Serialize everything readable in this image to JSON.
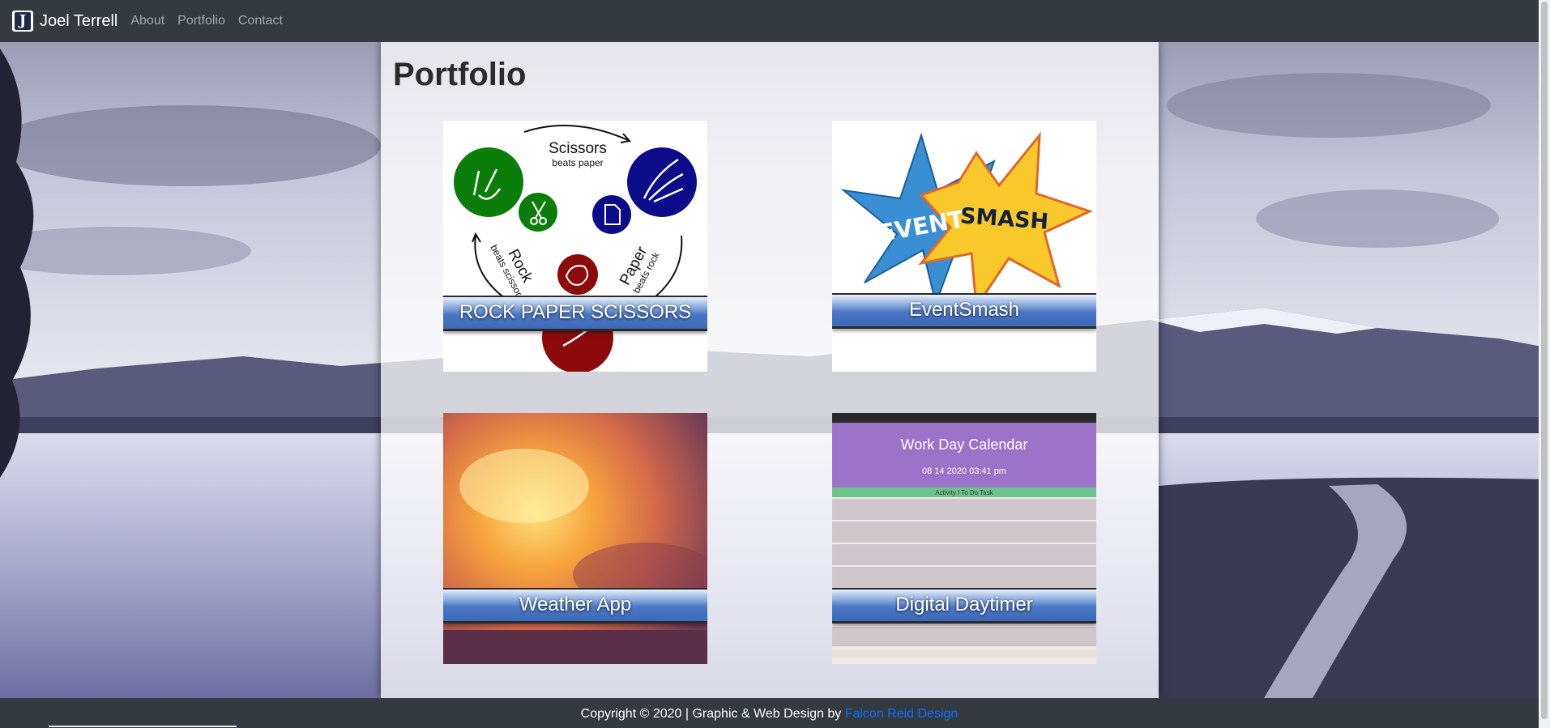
{
  "navbar": {
    "brand_letter": "J",
    "brand_name": "Joel Terrell",
    "links": [
      "About",
      "Portfolio",
      "Contact"
    ]
  },
  "main": {
    "title": "Portfolio",
    "projects": [
      {
        "label": "ROCK PAPER SCISSORS",
        "art_text": {
          "scissors": "Scissors",
          "scissors_beats": "beats paper",
          "rock": "Rock",
          "rock_beats": "beats scissors",
          "paper": "Paper",
          "paper_beats": "beats rock"
        }
      },
      {
        "label": "EventSmash",
        "art_text": {
          "event": "EVENT",
          "smash": "SMASH"
        }
      },
      {
        "label": "Weather App"
      },
      {
        "label": "Digital Daytimer",
        "art_text": {
          "heading": "Work Day Calendar",
          "datetime": "08 14 2020 03:41 pm",
          "row_label": "Activity / To Do Task"
        }
      }
    ]
  },
  "footer": {
    "copyright": "Copyright © 2020 | Graphic & Web Design by ",
    "link_text": "Falcon Reid Design"
  },
  "colors": {
    "navbar_bg": "#343a40",
    "link_blue": "#0d6efd",
    "ribbon_blue": "#4a76c3"
  }
}
